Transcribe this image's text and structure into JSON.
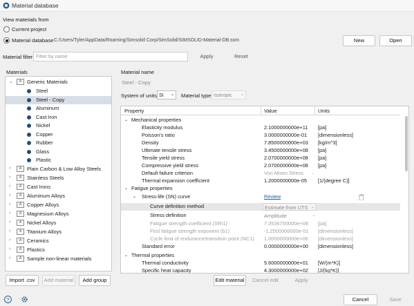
{
  "window": {
    "title": "Material database"
  },
  "source": {
    "heading": "View materials from",
    "option_project": "Current project",
    "option_database": "Material database",
    "database_path": "C:/Users/Tyler/AppData/Roaming/Simsolid Corp/SimSolid/SIMSOLID-Material-DB.ssm",
    "new_label": "New",
    "open_label": "Open"
  },
  "filter": {
    "label": "Material filter",
    "placeholder": "Filter by name",
    "apply_label": "Apply",
    "reset_label": "Reset"
  },
  "materials": {
    "heading": "Materials",
    "generic": {
      "label": "Generic Materials",
      "items": [
        "Steel",
        "Steel - Copy",
        "Aluminum",
        "Cast Iron",
        "Nickel",
        "Copper",
        "Rubber",
        "Glass",
        "Plastic"
      ]
    },
    "groups": [
      "Plain Carbon & Low Alloy Steels",
      "Stainless Steels",
      "Cast Irons",
      "Aluminum Alloys",
      "Copper Alloys",
      "Magnesium Alloys",
      "Nickel Alloys",
      "Titanium Alloys",
      "Ceramics",
      "Plastics",
      "Sample non-linear materials"
    ]
  },
  "buttons_left": {
    "import": "Import .csv",
    "add_material": "Add material",
    "add_group": "Add group"
  },
  "material": {
    "name_label": "Material name",
    "name_value": "Steel - Copy",
    "units_label": "System of units",
    "units_value": "SI",
    "type_label": "Material type",
    "type_value": "isotropic"
  },
  "table": {
    "headers": {
      "property": "Property",
      "value": "Value",
      "units": "Units"
    },
    "mech_section": "Mechanical properties",
    "mech_rows": [
      {
        "name": "Elasticity modulus",
        "value": "2.1000000000e+11",
        "units": "[pa]"
      },
      {
        "name": "Poisson's ratio",
        "value": "3.0000000000e-01",
        "units": "[dimensionless]"
      },
      {
        "name": "Density",
        "value": "7.8500000000e+03",
        "units": "[kg/m^3]"
      },
      {
        "name": "Ultimate tensile stress",
        "value": "3.4500000000e+08",
        "units": "[pa]"
      },
      {
        "name": "Tensile yield stress",
        "value": "2.0700000000e+08",
        "units": "[pa]"
      },
      {
        "name": "Compressive yield stress",
        "value": "2.0700000000e+08",
        "units": "[pa]"
      },
      {
        "name": "Default failure criterion",
        "value": "Von Mises Stress",
        "units": ""
      },
      {
        "name": "Thermal expansion coefficient",
        "value": "1.2000000000e-05",
        "units": "[1/(degree C)]"
      }
    ],
    "fatigue_section": "Fatigue properties",
    "sn_label": "Stress-life (SN) curve",
    "review_label": "Review",
    "curve_method_label": "Curve definition method",
    "curve_method_value": "Estimate from UTS",
    "stress_def_label": "Stress definition",
    "stress_def_value": "Amplitude",
    "fatigue_rows": [
      {
        "name": "Fatigue strength coefficient (SRI1)",
        "value": "7.3536750000e+08",
        "units": "[pa]"
      },
      {
        "name": "First fatigue strength exponent (b1)",
        "value": "-1.2500000000e-01",
        "units": "[dimensionless]"
      },
      {
        "name": "Cycle limit of endurance/transition point (NC1)",
        "value": "1.0000000000e+06",
        "units": "[dimensionless]"
      }
    ],
    "std_error": {
      "name": "Standard error",
      "value": "0.0000000000e+00",
      "units": "[dimensionless]"
    },
    "thermal_section": "Thermal properties",
    "thermal_rows": [
      {
        "name": "Thermal conductivity",
        "value": "5.6000000000e+01",
        "units": "[W/(m*K)]"
      },
      {
        "name": "Specific heat capacity",
        "value": "4.3000000000e+02",
        "units": "[J/(kg*K)]"
      }
    ]
  },
  "buttons_mid": {
    "edit": "Edit material",
    "cancel_edit": "Cancel edit",
    "apply": "Apply"
  },
  "footer": {
    "cancel": "Cancel",
    "save": "Save"
  }
}
